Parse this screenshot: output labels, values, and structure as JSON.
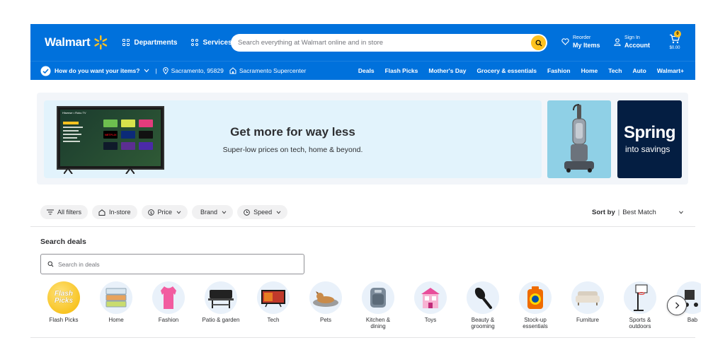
{
  "header": {
    "logo_text": "Walmart",
    "departments": "Departments",
    "services": "Services",
    "search_placeholder": "Search everything at Walmart online and in store",
    "reorder_small": "Reorder",
    "reorder_big": "My Items",
    "signin_small": "Sign In",
    "signin_big": "Account",
    "cart_count": "0",
    "cart_total": "$0.00",
    "brand_color": "#0071dc",
    "accent_color": "#ffc220"
  },
  "subnav": {
    "delivery_prompt": "How do you want your items?",
    "location": "Sacramento, 95829",
    "store": "Sacramento Supercenter",
    "links": [
      "Deals",
      "Flash Picks",
      "Mother's Day",
      "Grocery & essentials",
      "Fashion",
      "Home",
      "Tech",
      "Auto",
      "Walmart+"
    ]
  },
  "hero": {
    "title": "Get more for way less",
    "subtitle": "Super-low prices on tech, home & beyond.",
    "tv_brand": "Hisense • Roku TV",
    "spring_title": "Spring",
    "spring_sub": "into savings"
  },
  "filters": {
    "pills": [
      "All filters",
      "In-store",
      "Price",
      "Brand",
      "Speed"
    ],
    "sort_label": "Sort by",
    "sort_value": "Best Match"
  },
  "search_deals": {
    "title": "Search deals",
    "placeholder": "Search in deals"
  },
  "categories": [
    {
      "label": "Flash Picks",
      "label2": "",
      "icon": "flash-picks-icon"
    },
    {
      "label": "Home",
      "label2": "",
      "icon": "containers-icon"
    },
    {
      "label": "Fashion",
      "label2": "",
      "icon": "shirt-icon"
    },
    {
      "label": "Patio & garden",
      "label2": "",
      "icon": "grill-icon"
    },
    {
      "label": "Tech",
      "label2": "",
      "icon": "tv-icon"
    },
    {
      "label": "Pets",
      "label2": "",
      "icon": "dog-bed-icon"
    },
    {
      "label": "Kitchen &",
      "label2": "dining",
      "icon": "air-fryer-icon"
    },
    {
      "label": "Toys",
      "label2": "",
      "icon": "dollhouse-icon"
    },
    {
      "label": "Beauty &",
      "label2": "grooming",
      "icon": "hair-brush-icon"
    },
    {
      "label": "Stock-up",
      "label2": "essentials",
      "icon": "detergent-icon"
    },
    {
      "label": "Furniture",
      "label2": "",
      "icon": "sofa-icon"
    },
    {
      "label": "Sports &",
      "label2": "outdoors",
      "icon": "basketball-hoop-icon"
    },
    {
      "label": "Bab",
      "label2": "",
      "icon": "stroller-icon"
    }
  ],
  "flash_picks_badge": [
    "Flash",
    "Picks"
  ]
}
